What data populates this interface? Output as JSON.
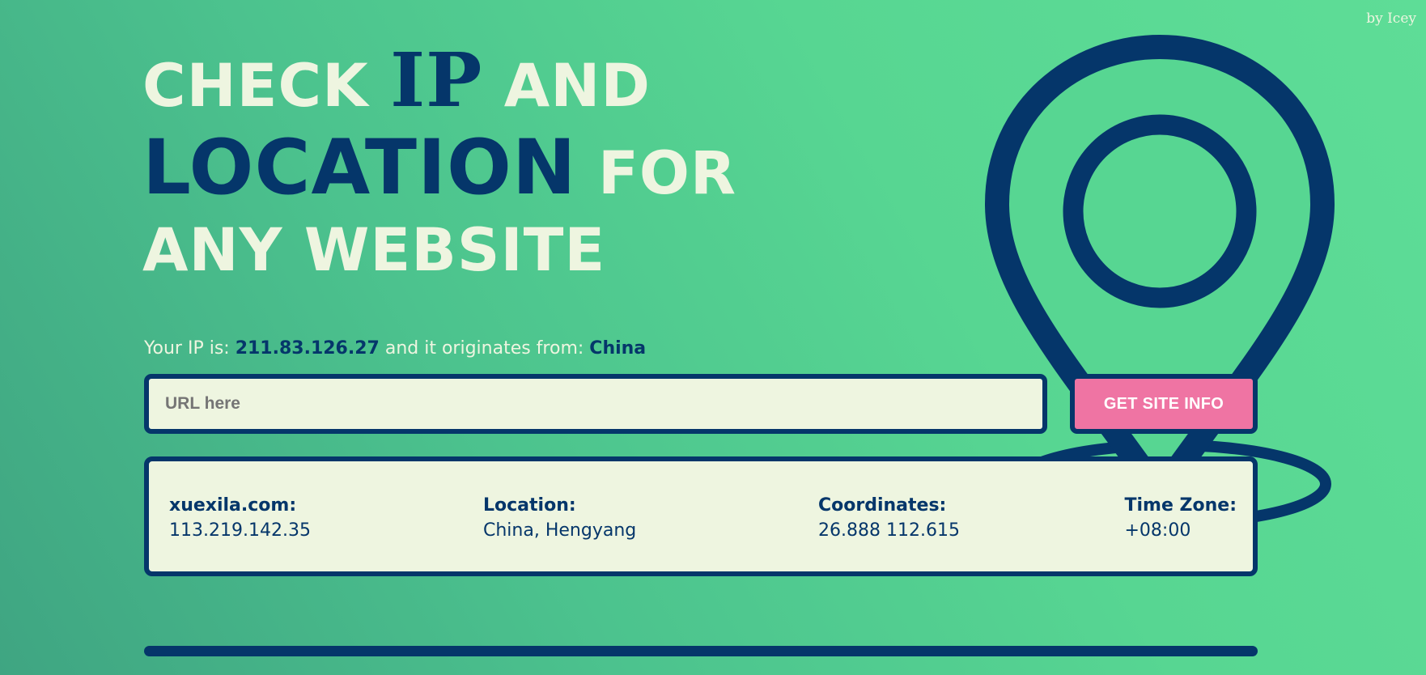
{
  "credit": "by Icey",
  "headline": {
    "line1_a": "CHECK ",
    "line1_b": "IP",
    "line1_c": " AND",
    "line2_a": "LOCATION",
    "line2_b": " FOR",
    "line3": "ANY WEBSITE"
  },
  "visitor": {
    "prefix": "Your IP is: ",
    "ip": "211.83.126.27",
    "middle": " and it originates from: ",
    "country": "China"
  },
  "search": {
    "placeholder": "URL here",
    "value": "",
    "button_label": "GET SITE INFO"
  },
  "result": {
    "domain_label": "xuexila.com:",
    "domain_ip": "113.219.142.35",
    "location_label": "Location:",
    "location_value": "China, Hengyang",
    "coordinates_label": "Coordinates:",
    "coordinates_value": "26.888 112.615",
    "timezone_label": "Time Zone:",
    "timezone_value": "+08:00"
  },
  "colors": {
    "accent_dark": "#05366a",
    "light_text": "#eef5e0",
    "button_pink": "#ef74a3",
    "background_green": "#57d692"
  },
  "icons": {
    "pin": "location-pin-icon"
  }
}
